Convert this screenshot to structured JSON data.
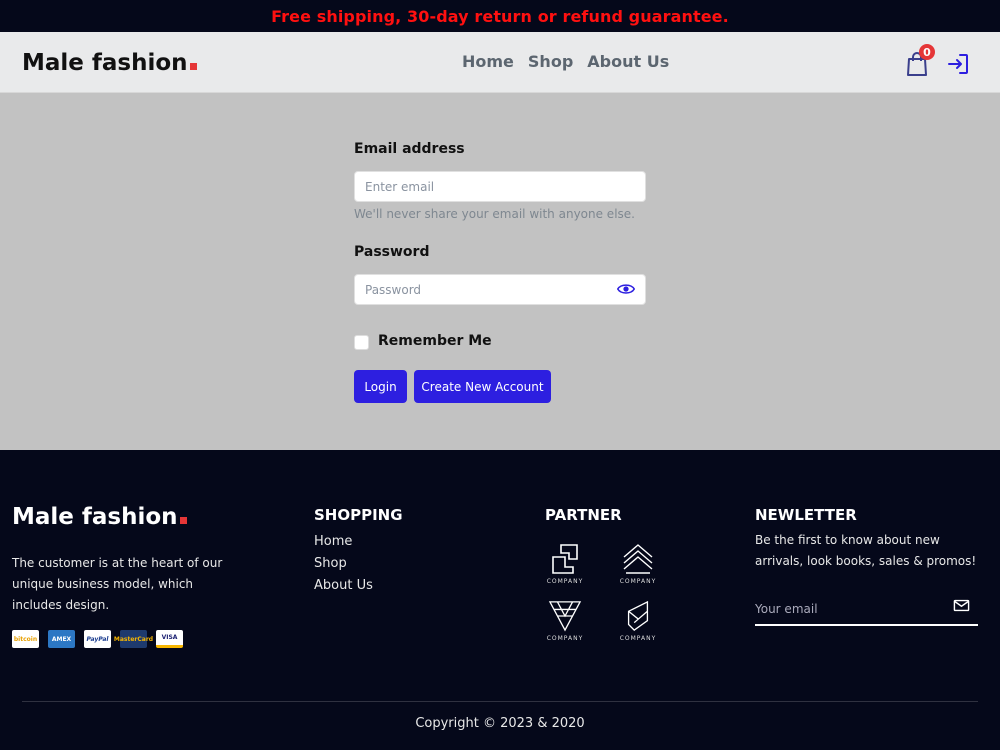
{
  "promo": {
    "text": "Free shipping, 30-day return or refund guarantee."
  },
  "header": {
    "logo": "Male fashion",
    "nav": [
      "Home",
      "Shop",
      "About Us"
    ],
    "cart_count": "0"
  },
  "login_form": {
    "email_label": "Email address",
    "email_placeholder": "Enter email",
    "email_hint": "We'll never share your email with anyone else.",
    "password_label": "Password",
    "password_placeholder": "Password",
    "remember_label": "Remember Me",
    "login_button": "Login",
    "create_button": "Create New Account"
  },
  "footer": {
    "logo": "Male fashion",
    "description": "The customer is at the heart of our unique business model, which includes design.",
    "payments": [
      "bitcoin",
      "AMEX",
      "PayPal",
      "MasterCard",
      "VISA"
    ],
    "shopping": {
      "title": "SHOPPING",
      "links": [
        "Home",
        "Shop",
        "About Us"
      ]
    },
    "partner": {
      "title": "PARTNER",
      "names": [
        "COMPANY",
        "COMPANY",
        "COMPANY",
        "COMPANY"
      ]
    },
    "newsletter": {
      "title": "NEWLETTER",
      "description": "Be the first to know about new arrivals, look books, sales & promos!",
      "placeholder": "Your email"
    },
    "copyright": "Copyright © 2023 & 2020"
  },
  "colors": {
    "primary": "#2d1fe0",
    "accent": "#e53637",
    "dark": "#05081a",
    "promo": "#ff1010"
  }
}
